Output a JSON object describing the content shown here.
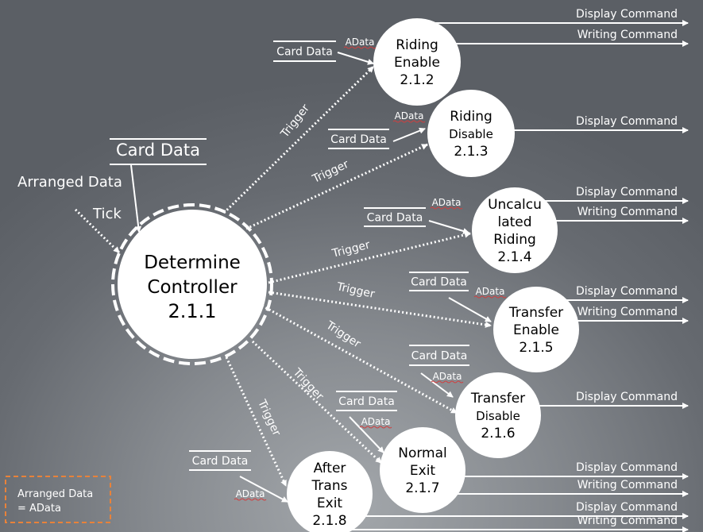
{
  "colors": {
    "background": "#676b71",
    "process_fill": "#ffffff",
    "flow": "#ffffff",
    "legend_border": "#e8823a"
  },
  "main_process": {
    "lines": [
      "Determine",
      "Controller",
      "2.1.1"
    ]
  },
  "main_inputs": {
    "card_data": "Card Data",
    "arranged_data": "Arranged Data",
    "tick": "Tick"
  },
  "flow_labels": {
    "trigger": "Trigger",
    "card_data": "Card Data",
    "adata": "AData",
    "display": "Display Command",
    "writing": "Writing Command"
  },
  "processes": [
    {
      "id": "2.1.2",
      "lines": [
        "Riding",
        "Enable",
        "2.1.2"
      ],
      "outputs": [
        "Display Command",
        "Writing Command"
      ]
    },
    {
      "id": "2.1.3",
      "lines": [
        "Riding",
        "Disable",
        "2.1.3"
      ],
      "outputs": [
        "Display Command"
      ]
    },
    {
      "id": "2.1.4",
      "lines": [
        "Uncalcu",
        "lated",
        "Riding",
        "2.1.4"
      ],
      "outputs": [
        "Display Command",
        "Writing Command"
      ]
    },
    {
      "id": "2.1.5",
      "lines": [
        "Transfer",
        "Enable",
        "2.1.5"
      ],
      "outputs": [
        "Display Command",
        "Writing Command"
      ]
    },
    {
      "id": "2.1.6",
      "lines": [
        "Transfer",
        "Disable",
        "2.1.6"
      ],
      "outputs": [
        "Display Command"
      ]
    },
    {
      "id": "2.1.7",
      "lines": [
        "Normal",
        "Exit",
        "2.1.7"
      ],
      "outputs": [
        "Display Command",
        "Writing Command"
      ]
    },
    {
      "id": "2.1.8",
      "lines": [
        "After",
        "Trans",
        "Exit",
        "2.1.8"
      ],
      "outputs": [
        "Display Command",
        "Writing Command"
      ]
    }
  ],
  "legend": {
    "line1": "Arranged Data",
    "line2": "= AData"
  }
}
